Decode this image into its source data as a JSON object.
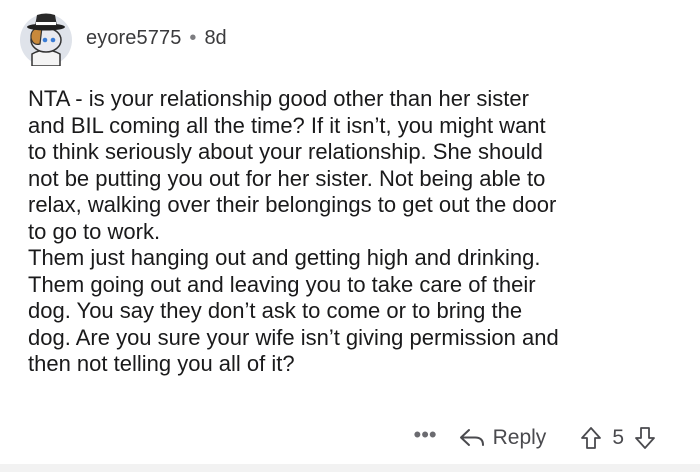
{
  "comment": {
    "author": "eyore5775",
    "separator": "•",
    "age": "8d",
    "body": [
      "NTA - is your relationship good other than her sister\nand BIL coming all the time?  If it isn’t, you might want\nto think seriously about your relationship.  She should\nnot be putting you out for her sister.  Not being able to\nrelax, walking over their belongings to get out the door\nto go to work.",
      "Them just hanging out and getting high and drinking.\nThem going out and leaving you to take care of their\ndog.  You say they don’t ask to come or to bring the\ndog.  Are you sure your wife isn’t giving permission and\nthen not telling you all of it?"
    ],
    "actions": {
      "more": "•••",
      "reply": "Reply",
      "score": "5"
    }
  },
  "icons": {
    "avatar": "snoo-avatar-with-fedora",
    "more": "more-icon",
    "reply": "reply-arrow-icon",
    "upvote": "upvote-arrow-icon",
    "downvote": "downvote-arrow-icon"
  }
}
